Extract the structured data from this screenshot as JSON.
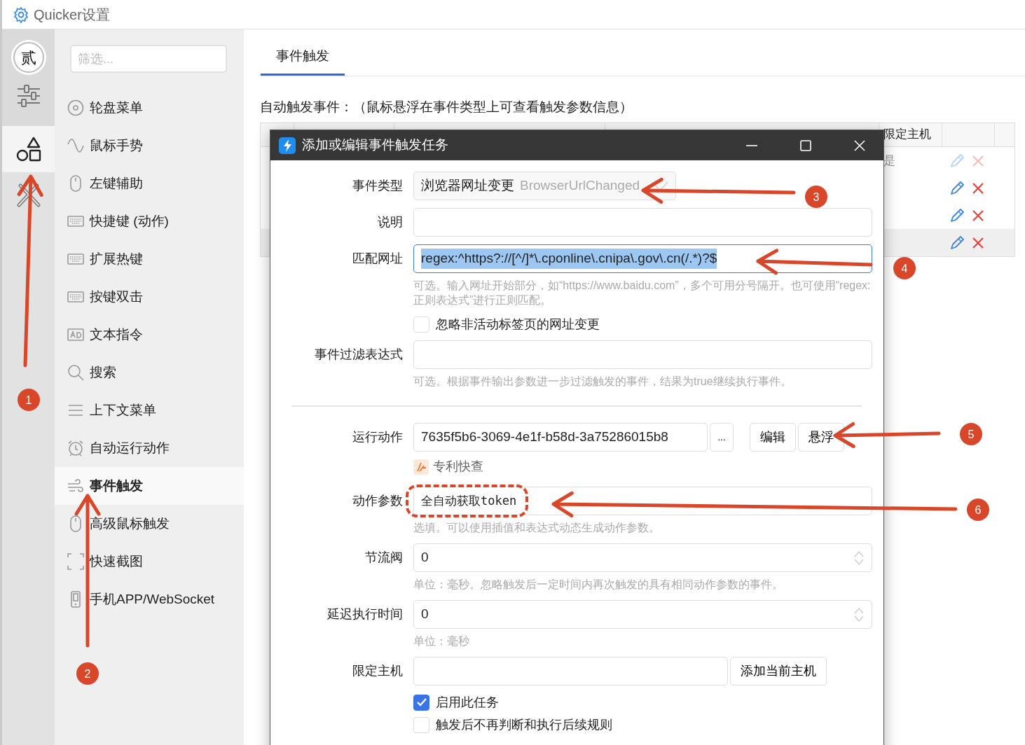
{
  "window": {
    "title": "Quicker设置"
  },
  "rail": {
    "avatar": "贰",
    "items": [
      {
        "kind": "sliders",
        "selected": false
      },
      {
        "kind": "shapes",
        "selected": true
      },
      {
        "kind": "tools",
        "selected": false
      }
    ]
  },
  "sidebar": {
    "filter": {
      "placeholder": "筛选..."
    },
    "items": [
      {
        "label": "轮盘菜单",
        "kind": "wheel",
        "selected": false
      },
      {
        "label": "鼠标手势",
        "kind": "wave",
        "selected": false
      },
      {
        "label": "左键辅助",
        "kind": "mouse",
        "selected": false
      },
      {
        "label": "快捷键 (动作)",
        "kind": "keyboard",
        "selected": false
      },
      {
        "label": "扩展热键",
        "kind": "keyboard",
        "selected": false
      },
      {
        "label": "按键双击",
        "kind": "keyboard",
        "selected": false
      },
      {
        "label": "文本指令",
        "kind": "ad",
        "selected": false
      },
      {
        "label": "搜索",
        "kind": "search",
        "selected": false
      },
      {
        "label": "上下文菜单",
        "kind": "menu",
        "selected": false
      },
      {
        "label": "自动运行动作",
        "kind": "alarm",
        "selected": false
      },
      {
        "label": "事件触发",
        "kind": "wind",
        "selected": true
      },
      {
        "label": "高级鼠标触发",
        "kind": "mouse",
        "selected": false
      },
      {
        "label": "快速截图",
        "kind": "crop",
        "selected": false
      },
      {
        "label": "手机APP/WebSocket",
        "kind": "phone",
        "selected": false
      }
    ]
  },
  "tabs": [
    {
      "label": "事件触发",
      "selected": true
    }
  ],
  "section_label": "自动触发事件：（鼠标悬浮在事件类型上可查看触发参数信息）",
  "table": {
    "columns": [
      "限定主机"
    ],
    "rows": [
      {
        "host": "是",
        "disabled": true,
        "selected": false
      },
      {
        "disabled": false,
        "selected": false
      },
      {
        "disabled": false,
        "selected": false
      },
      {
        "disabled": false,
        "selected": true
      }
    ]
  },
  "dialog": {
    "title": "添加或编辑事件触发任务",
    "fields": [
      {
        "kind": "combo",
        "label": "事件类型",
        "value": "浏览器网址变更",
        "secondary": "BrowserUrlChanged"
      },
      {
        "kind": "text",
        "label": "说明"
      },
      {
        "kind": "text",
        "label": "匹配网址",
        "value": "regex:^https?://[^/]*\\.cponline\\.cnipa\\.gov\\.cn(/.*)?$",
        "focused": true,
        "text_selected": true,
        "hint": "可选。输入网址开始部分，如“https://www.baidu.com”，多个可用分号隔开。也可使用“regex:正则表达式”进行正则匹配。"
      },
      {
        "kind": "checkbox",
        "label": "忽略非活动标签页的网址变更",
        "checked": false
      },
      {
        "kind": "text",
        "label": "事件过滤表达式",
        "hint": "可选。根据事件输出参数进一步过滤触发的事件，结果为true继续执行事件。"
      },
      {
        "kind": "divider"
      },
      {
        "kind": "action",
        "label": "运行动作",
        "value": "7635f5b6-3069-4e1f-b58d-3a75286015b8",
        "buttons": [
          "...",
          "编辑",
          "悬浮"
        ],
        "action_name": "专利快查"
      },
      {
        "kind": "text",
        "label": "动作参数",
        "value": "全自动获取token",
        "mono": true,
        "hint": "选填。可以使用插值和表达式动态生成动作参数。"
      },
      {
        "kind": "number",
        "label": "节流阀",
        "value": "0",
        "hint": "单位：毫秒。忽略触发后一定时间内再次触发的具有相同动作参数的事件。"
      },
      {
        "kind": "number",
        "label": "延迟执行时间",
        "value": "0",
        "hint": "单位：毫秒"
      },
      {
        "kind": "host",
        "label": "限定主机",
        "button": "添加当前主机"
      },
      {
        "kind": "checkbox",
        "label": "启用此任务",
        "checked": true
      },
      {
        "kind": "checkbox",
        "label": "触发后不再判断和执行后续规则",
        "checked": false
      }
    ]
  },
  "annotations": {
    "badges": [
      "1",
      "2",
      "3",
      "4",
      "5",
      "6"
    ]
  }
}
